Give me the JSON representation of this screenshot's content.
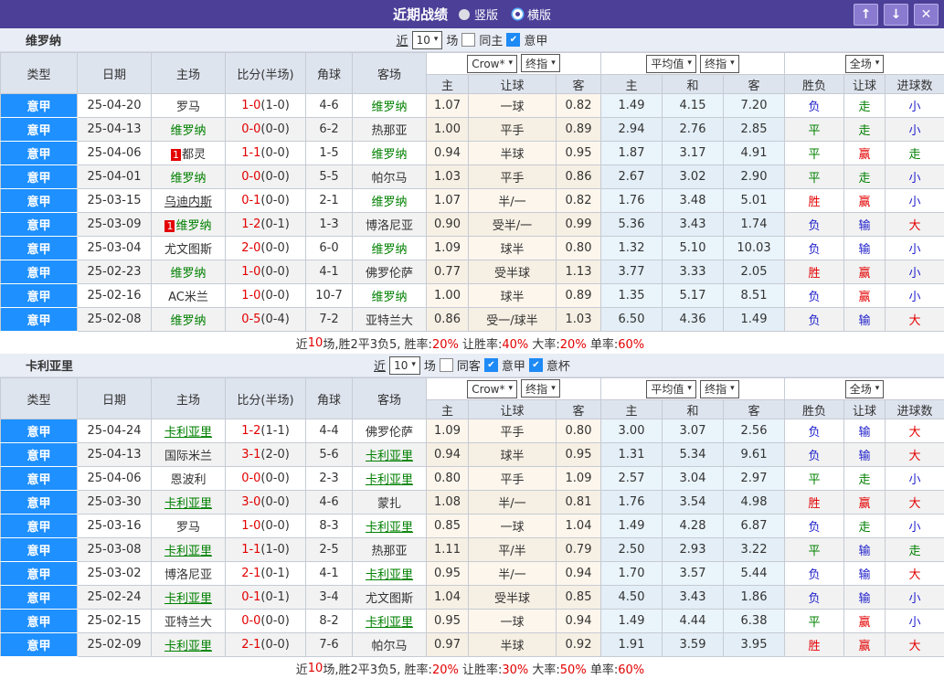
{
  "titlebar": {
    "title": "近期战绩",
    "radios": [
      {
        "label": "竖版",
        "icon": "disc"
      },
      {
        "label": "横版",
        "icon": "ring"
      }
    ],
    "buttons": {
      "up": "↑",
      "down": "↓",
      "close": "✕"
    }
  },
  "colors": {
    "title_bg": "#4b3f98",
    "league_cell_blue": "#1e90ff",
    "focus_team_green": "#008000",
    "win_red": "#e30000",
    "draw_green": "#008000",
    "loss_blue": "#2222cc",
    "crow_col_bg": "#fdf6ec",
    "avg_col_bg": "#eaf4fb",
    "header_bg": "#dee4ee",
    "section_bar_bg": "#e9edf6"
  },
  "table_header": {
    "left_cols": [
      "类型",
      "日期",
      "主场",
      "比分(半场)",
      "角球",
      "客场"
    ],
    "crow_dropdowns": [
      "Crow*",
      "终指"
    ],
    "crow_cols": [
      "主",
      "让球",
      "客"
    ],
    "avg_dropdowns": [
      "平均值",
      "终指"
    ],
    "avg_cols": [
      "主",
      "和",
      "客"
    ],
    "full_dropdown": "全场",
    "result_cols": [
      "胜负",
      "让球",
      "进球数"
    ]
  },
  "sections": [
    {
      "team": "维罗纳",
      "controls": {
        "near_label": "近",
        "count": "10",
        "games_label": "场",
        "same_label": "同主",
        "same_checked": false,
        "leagues": [
          {
            "label": "意甲",
            "checked": true
          }
        ]
      },
      "rows": [
        {
          "league": "意甲",
          "date": "25-04-20",
          "home": {
            "name": "罗马"
          },
          "score": "1-0",
          "half": "(1-0)",
          "corner": "4-6",
          "away": {
            "name": "维罗纳",
            "focus": true
          },
          "crow": [
            "1.07",
            "一球",
            "0.82"
          ],
          "avg": [
            "1.49",
            "4.15",
            "7.20"
          ],
          "result": [
            "负",
            "走",
            "小"
          ]
        },
        {
          "league": "意甲",
          "date": "25-04-13",
          "home": {
            "name": "维罗纳",
            "focus": true
          },
          "score": "0-0",
          "half": "(0-0)",
          "corner": "6-2",
          "away": {
            "name": "热那亚"
          },
          "crow": [
            "1.00",
            "平手",
            "0.89"
          ],
          "avg": [
            "2.94",
            "2.76",
            "2.85"
          ],
          "result": [
            "平",
            "走",
            "小"
          ]
        },
        {
          "league": "意甲",
          "date": "25-04-06",
          "home": {
            "name": "都灵",
            "badge": "1"
          },
          "score": "1-1",
          "half": "(0-0)",
          "corner": "1-5",
          "away": {
            "name": "维罗纳",
            "focus": true
          },
          "crow": [
            "0.94",
            "半球",
            "0.95"
          ],
          "avg": [
            "1.87",
            "3.17",
            "4.91"
          ],
          "result": [
            "平",
            "赢",
            "走"
          ]
        },
        {
          "league": "意甲",
          "date": "25-04-01",
          "home": {
            "name": "维罗纳",
            "focus": true
          },
          "score": "0-0",
          "half": "(0-0)",
          "corner": "5-5",
          "away": {
            "name": "帕尔马"
          },
          "crow": [
            "1.03",
            "平手",
            "0.86"
          ],
          "avg": [
            "2.67",
            "3.02",
            "2.90"
          ],
          "result": [
            "平",
            "走",
            "小"
          ]
        },
        {
          "league": "意甲",
          "date": "25-03-15",
          "home": {
            "name": "乌迪内斯",
            "underline": true
          },
          "score": "0-1",
          "half": "(0-0)",
          "corner": "2-1",
          "away": {
            "name": "维罗纳",
            "focus": true
          },
          "crow": [
            "1.07",
            "半/一",
            "0.82"
          ],
          "avg": [
            "1.76",
            "3.48",
            "5.01"
          ],
          "result": [
            "胜",
            "赢",
            "小"
          ]
        },
        {
          "league": "意甲",
          "date": "25-03-09",
          "home": {
            "name": "维罗纳",
            "focus": true,
            "badge": "1"
          },
          "score": "1-2",
          "half": "(0-1)",
          "corner": "1-3",
          "away": {
            "name": "博洛尼亚"
          },
          "crow": [
            "0.90",
            "受半/一",
            "0.99"
          ],
          "avg": [
            "5.36",
            "3.43",
            "1.74"
          ],
          "result": [
            "负",
            "输",
            "大"
          ]
        },
        {
          "league": "意甲",
          "date": "25-03-04",
          "home": {
            "name": "尤文图斯"
          },
          "score": "2-0",
          "half": "(0-0)",
          "corner": "6-0",
          "away": {
            "name": "维罗纳",
            "focus": true
          },
          "crow": [
            "1.09",
            "球半",
            "0.80"
          ],
          "avg": [
            "1.32",
            "5.10",
            "10.03"
          ],
          "result": [
            "负",
            "输",
            "小"
          ]
        },
        {
          "league": "意甲",
          "date": "25-02-23",
          "home": {
            "name": "维罗纳",
            "focus": true
          },
          "score": "1-0",
          "half": "(0-0)",
          "corner": "4-1",
          "away": {
            "name": "佛罗伦萨"
          },
          "crow": [
            "0.77",
            "受半球",
            "1.13"
          ],
          "avg": [
            "3.77",
            "3.33",
            "2.05"
          ],
          "result": [
            "胜",
            "赢",
            "小"
          ]
        },
        {
          "league": "意甲",
          "date": "25-02-16",
          "home": {
            "name": "AC米兰"
          },
          "score": "1-0",
          "half": "(0-0)",
          "corner": "10-7",
          "away": {
            "name": "维罗纳",
            "focus": true
          },
          "crow": [
            "1.00",
            "球半",
            "0.89"
          ],
          "avg": [
            "1.35",
            "5.17",
            "8.51"
          ],
          "result": [
            "负",
            "赢",
            "小"
          ]
        },
        {
          "league": "意甲",
          "date": "25-02-08",
          "home": {
            "name": "维罗纳",
            "focus": true
          },
          "score": "0-5",
          "half": "(0-4)",
          "corner": "7-2",
          "away": {
            "name": "亚特兰大"
          },
          "crow": [
            "0.86",
            "受一/球半",
            "1.03"
          ],
          "avg": [
            "6.50",
            "4.36",
            "1.49"
          ],
          "result": [
            "负",
            "输",
            "大"
          ]
        }
      ],
      "summary": {
        "games_prefix": "近",
        "games_count": "10",
        "games_suffix": "场,胜2平3负5, ",
        "stats": [
          {
            "label": "胜率:",
            "value": "20%"
          },
          {
            "label": "让胜率:",
            "value": "40%"
          },
          {
            "label": "大率:",
            "value": "20%"
          },
          {
            "label": "单率:",
            "value": "60%"
          }
        ]
      }
    },
    {
      "team": "卡利亚里",
      "controls": {
        "near_label": "近",
        "count": "10",
        "games_label": "场",
        "same_label": "同客",
        "same_checked": false,
        "leagues": [
          {
            "label": "意甲",
            "checked": true
          },
          {
            "label": "意杯",
            "checked": true
          }
        ]
      },
      "rows": [
        {
          "league": "意甲",
          "date": "25-04-24",
          "home": {
            "name": "卡利亚里",
            "focus": true,
            "underline": true
          },
          "score": "1-2",
          "half": "(1-1)",
          "corner": "4-4",
          "away": {
            "name": "佛罗伦萨"
          },
          "crow": [
            "1.09",
            "平手",
            "0.80"
          ],
          "avg": [
            "3.00",
            "3.07",
            "2.56"
          ],
          "result": [
            "负",
            "输",
            "大"
          ]
        },
        {
          "league": "意甲",
          "date": "25-04-13",
          "home": {
            "name": "国际米兰"
          },
          "score": "3-1",
          "half": "(2-0)",
          "corner": "5-6",
          "away": {
            "name": "卡利亚里",
            "focus": true,
            "underline": true
          },
          "crow": [
            "0.94",
            "球半",
            "0.95"
          ],
          "avg": [
            "1.31",
            "5.34",
            "9.61"
          ],
          "result": [
            "负",
            "输",
            "大"
          ]
        },
        {
          "league": "意甲",
          "date": "25-04-06",
          "home": {
            "name": "恩波利"
          },
          "score": "0-0",
          "half": "(0-0)",
          "corner": "2-3",
          "away": {
            "name": "卡利亚里",
            "focus": true,
            "underline": true
          },
          "crow": [
            "0.80",
            "平手",
            "1.09"
          ],
          "avg": [
            "2.57",
            "3.04",
            "2.97"
          ],
          "result": [
            "平",
            "走",
            "小"
          ]
        },
        {
          "league": "意甲",
          "date": "25-03-30",
          "home": {
            "name": "卡利亚里",
            "focus": true,
            "underline": true
          },
          "score": "3-0",
          "half": "(0-0)",
          "corner": "4-6",
          "away": {
            "name": "蒙扎"
          },
          "crow": [
            "1.08",
            "半/一",
            "0.81"
          ],
          "avg": [
            "1.76",
            "3.54",
            "4.98"
          ],
          "result": [
            "胜",
            "赢",
            "大"
          ]
        },
        {
          "league": "意甲",
          "date": "25-03-16",
          "home": {
            "name": "罗马"
          },
          "score": "1-0",
          "half": "(0-0)",
          "corner": "8-3",
          "away": {
            "name": "卡利亚里",
            "focus": true,
            "underline": true
          },
          "crow": [
            "0.85",
            "一球",
            "1.04"
          ],
          "avg": [
            "1.49",
            "4.28",
            "6.87"
          ],
          "result": [
            "负",
            "走",
            "小"
          ]
        },
        {
          "league": "意甲",
          "date": "25-03-08",
          "home": {
            "name": "卡利亚里",
            "focus": true,
            "underline": true
          },
          "score": "1-1",
          "half": "(1-0)",
          "corner": "2-5",
          "away": {
            "name": "热那亚"
          },
          "crow": [
            "1.11",
            "平/半",
            "0.79"
          ],
          "avg": [
            "2.50",
            "2.93",
            "3.22"
          ],
          "result": [
            "平",
            "输",
            "走"
          ]
        },
        {
          "league": "意甲",
          "date": "25-03-02",
          "home": {
            "name": "博洛尼亚"
          },
          "score": "2-1",
          "half": "(0-1)",
          "corner": "4-1",
          "away": {
            "name": "卡利亚里",
            "focus": true,
            "underline": true
          },
          "crow": [
            "0.95",
            "半/一",
            "0.94"
          ],
          "avg": [
            "1.70",
            "3.57",
            "5.44"
          ],
          "result": [
            "负",
            "输",
            "大"
          ]
        },
        {
          "league": "意甲",
          "date": "25-02-24",
          "home": {
            "name": "卡利亚里",
            "focus": true,
            "underline": true
          },
          "score": "0-1",
          "half": "(0-1)",
          "corner": "3-4",
          "away": {
            "name": "尤文图斯"
          },
          "crow": [
            "1.04",
            "受半球",
            "0.85"
          ],
          "avg": [
            "4.50",
            "3.43",
            "1.86"
          ],
          "result": [
            "负",
            "输",
            "小"
          ]
        },
        {
          "league": "意甲",
          "date": "25-02-15",
          "home": {
            "name": "亚特兰大"
          },
          "score": "0-0",
          "half": "(0-0)",
          "corner": "8-2",
          "away": {
            "name": "卡利亚里",
            "focus": true,
            "underline": true
          },
          "crow": [
            "0.95",
            "一球",
            "0.94"
          ],
          "avg": [
            "1.49",
            "4.44",
            "6.38"
          ],
          "result": [
            "平",
            "赢",
            "小"
          ]
        },
        {
          "league": "意甲",
          "date": "25-02-09",
          "home": {
            "name": "卡利亚里",
            "focus": true,
            "underline": true
          },
          "score": "2-1",
          "half": "(0-0)",
          "corner": "7-6",
          "away": {
            "name": "帕尔马"
          },
          "crow": [
            "0.97",
            "半球",
            "0.92"
          ],
          "avg": [
            "1.91",
            "3.59",
            "3.95"
          ],
          "result": [
            "胜",
            "赢",
            "大"
          ]
        }
      ],
      "summary": {
        "games_prefix": "近",
        "games_count": "10",
        "games_suffix": "场,胜2平3负5, ",
        "stats": [
          {
            "label": "胜率:",
            "value": "20%"
          },
          {
            "label": "让胜率:",
            "value": "30%"
          },
          {
            "label": "大率:",
            "value": "50%"
          },
          {
            "label": "单率:",
            "value": "60%"
          }
        ]
      }
    }
  ]
}
